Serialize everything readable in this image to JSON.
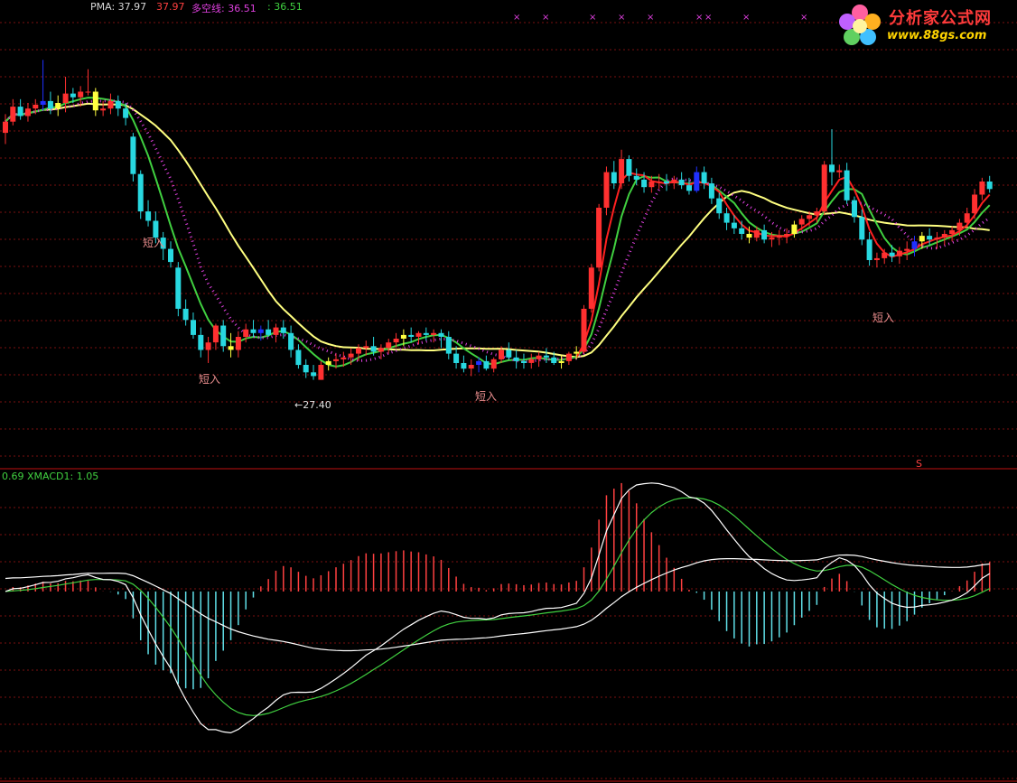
{
  "top_legend": {
    "pma_label": "PMA: 37.97",
    "pma_value2": "37.97",
    "dkx_label": "多空线: 36.51",
    "dkx_value2": ": 36.51"
  },
  "bottom_legend": {
    "left_label": "0.69 XMACD1: 1.05"
  },
  "logo": {
    "title": "分析家公式网",
    "url": "www.88gs.com"
  },
  "annotations": {
    "signal_1": "短入",
    "signal_2": "短入",
    "signal_3": "短入",
    "signal_4": "短入",
    "low_marker": "←27.40"
  },
  "colors": {
    "background": "#000000",
    "grid": "#7a1010",
    "up_candle": "#ff3030",
    "down_candle": "#28d8e0",
    "highlight_candle": "#ffff40",
    "blue_candle": "#2030ff",
    "yellow_ma": "#ffff80",
    "green_ma": "#40d040",
    "red_ma": "#ff2020",
    "pink_dot_ma": "#e040e0",
    "macd_white": "#ffffff",
    "macd_green": "#40d040",
    "hist_pos": "#ff4040",
    "hist_neg": "#60e0e8"
  },
  "chart_data": [
    {
      "type": "candlestick",
      "panel": "price",
      "title": "",
      "low_label": 27.4,
      "series": [
        {
          "name": "PMA",
          "last": 37.97
        },
        {
          "name": "多空线",
          "last": 36.51
        }
      ],
      "ohlc": [
        [
          40.6,
          41.6,
          40.0,
          41.2
        ],
        [
          41.2,
          42.4,
          41.0,
          42.0
        ],
        [
          42.0,
          42.4,
          41.3,
          41.5
        ],
        [
          41.5,
          42.2,
          41.2,
          41.9
        ],
        [
          41.9,
          42.4,
          41.6,
          42.1
        ],
        [
          42.1,
          44.5,
          41.8,
          42.3
        ],
        [
          42.3,
          42.8,
          41.6,
          41.9
        ],
        [
          41.9,
          42.6,
          41.5,
          42.2
        ],
        [
          42.2,
          43.6,
          41.7,
          42.7
        ],
        [
          42.7,
          43.0,
          42.2,
          42.5
        ],
        [
          42.5,
          43.1,
          42.0,
          42.8
        ],
        [
          42.8,
          44.0,
          42.6,
          42.8
        ],
        [
          42.8,
          43.0,
          41.5,
          41.8
        ],
        [
          41.8,
          42.3,
          41.5,
          41.9
        ],
        [
          41.9,
          42.7,
          41.6,
          42.3
        ],
        [
          42.3,
          42.6,
          41.5,
          41.9
        ],
        [
          41.9,
          42.2,
          41.0,
          41.4
        ],
        [
          40.4,
          40.6,
          38.0,
          38.4
        ],
        [
          38.4,
          38.6,
          36.0,
          36.4
        ],
        [
          36.4,
          37.0,
          35.6,
          35.9
        ],
        [
          35.9,
          36.4,
          34.7,
          35.0
        ],
        [
          35.0,
          35.3,
          33.8,
          34.4
        ],
        [
          34.4,
          34.8,
          33.4,
          33.7
        ],
        [
          33.4,
          33.7,
          30.8,
          31.2
        ],
        [
          31.2,
          31.7,
          30.3,
          30.6
        ],
        [
          30.6,
          31.0,
          29.6,
          29.8
        ],
        [
          29.8,
          30.2,
          28.6,
          29.0
        ],
        [
          29.0,
          29.7,
          28.3,
          29.4
        ],
        [
          29.4,
          30.4,
          29.0,
          30.3
        ],
        [
          30.3,
          30.6,
          28.9,
          29.2
        ],
        [
          29.2,
          29.9,
          28.6,
          29.0
        ],
        [
          29.0,
          30.0,
          28.6,
          29.7
        ],
        [
          29.7,
          30.4,
          29.4,
          30.1
        ],
        [
          30.1,
          30.6,
          29.7,
          29.9
        ],
        [
          29.9,
          30.3,
          29.5,
          30.1
        ],
        [
          30.1,
          30.6,
          29.7,
          29.8
        ],
        [
          29.8,
          30.4,
          29.4,
          30.2
        ],
        [
          30.2,
          30.6,
          29.6,
          29.9
        ],
        [
          29.9,
          30.3,
          28.6,
          29.0
        ],
        [
          29.0,
          29.3,
          28.0,
          28.2
        ],
        [
          28.2,
          28.5,
          27.5,
          27.8
        ],
        [
          27.8,
          28.2,
          27.4,
          27.6
        ],
        [
          27.4,
          28.4,
          27.4,
          28.2
        ],
        [
          28.2,
          28.6,
          27.9,
          28.4
        ],
        [
          28.4,
          28.8,
          28.0,
          28.5
        ],
        [
          28.5,
          28.9,
          28.1,
          28.6
        ],
        [
          28.6,
          29.1,
          28.2,
          28.8
        ],
        [
          28.8,
          29.3,
          28.4,
          29.1
        ],
        [
          29.1,
          29.5,
          28.7,
          29.2
        ],
        [
          29.2,
          29.7,
          28.7,
          28.9
        ],
        [
          28.9,
          29.3,
          28.5,
          29.1
        ],
        [
          29.1,
          29.6,
          28.8,
          29.4
        ],
        [
          29.4,
          29.9,
          29.1,
          29.6
        ],
        [
          29.6,
          30.1,
          29.2,
          29.8
        ],
        [
          29.8,
          30.2,
          29.4,
          29.7
        ],
        [
          29.7,
          30.0,
          29.3,
          29.9
        ],
        [
          29.9,
          30.2,
          29.5,
          29.8
        ],
        [
          29.8,
          30.1,
          29.4,
          29.9
        ],
        [
          29.9,
          30.1,
          29.1,
          29.7
        ],
        [
          29.7,
          30.0,
          28.5,
          28.8
        ],
        [
          28.8,
          29.2,
          28.0,
          28.3
        ],
        [
          28.3,
          28.7,
          27.8,
          28.0
        ],
        [
          28.0,
          28.5,
          27.6,
          28.2
        ],
        [
          28.2,
          28.6,
          27.8,
          28.4
        ],
        [
          28.4,
          28.7,
          27.9,
          28.0
        ],
        [
          28.0,
          28.6,
          27.8,
          28.5
        ],
        [
          28.5,
          29.2,
          28.3,
          29.0
        ],
        [
          29.0,
          29.4,
          28.5,
          28.6
        ],
        [
          28.6,
          29.0,
          28.0,
          28.4
        ],
        [
          28.4,
          28.8,
          28.0,
          28.3
        ],
        [
          28.3,
          28.8,
          28.0,
          28.5
        ],
        [
          28.5,
          28.9,
          28.1,
          28.7
        ],
        [
          28.7,
          29.1,
          28.3,
          28.6
        ],
        [
          28.6,
          28.9,
          28.2,
          28.3
        ],
        [
          28.3,
          28.7,
          28.0,
          28.4
        ],
        [
          28.4,
          28.9,
          28.2,
          28.8
        ],
        [
          28.8,
          29.2,
          28.5,
          28.9
        ],
        [
          28.9,
          31.4,
          28.8,
          31.2
        ],
        [
          31.2,
          33.6,
          31.0,
          33.4
        ],
        [
          33.4,
          36.8,
          33.2,
          36.6
        ],
        [
          36.6,
          38.8,
          36.2,
          38.5
        ],
        [
          38.5,
          39.1,
          37.6,
          37.9
        ],
        [
          37.9,
          39.7,
          37.6,
          39.2
        ],
        [
          39.2,
          39.4,
          38.0,
          38.3
        ],
        [
          38.3,
          38.7,
          37.8,
          38.1
        ],
        [
          38.1,
          38.5,
          37.4,
          37.7
        ],
        [
          37.7,
          38.3,
          37.4,
          38.0
        ],
        [
          38.0,
          38.4,
          37.6,
          38.0
        ],
        [
          38.0,
          38.4,
          37.5,
          37.9
        ],
        [
          37.9,
          38.3,
          37.6,
          38.1
        ],
        [
          38.1,
          38.5,
          37.6,
          37.8
        ],
        [
          37.8,
          38.2,
          37.3,
          37.5
        ],
        [
          37.5,
          38.8,
          37.4,
          38.5
        ],
        [
          38.5,
          38.8,
          37.6,
          37.9
        ],
        [
          37.9,
          38.2,
          36.8,
          37.1
        ],
        [
          37.1,
          37.4,
          36.0,
          36.3
        ],
        [
          36.3,
          36.6,
          35.4,
          35.8
        ],
        [
          35.8,
          36.2,
          35.2,
          35.5
        ],
        [
          35.5,
          35.9,
          34.9,
          35.2
        ],
        [
          35.2,
          35.6,
          34.7,
          35.0
        ],
        [
          35.0,
          35.6,
          34.8,
          35.4
        ],
        [
          35.4,
          35.7,
          34.7,
          34.9
        ],
        [
          34.9,
          35.3,
          34.5,
          35.0
        ],
        [
          35.0,
          35.4,
          34.6,
          35.1
        ],
        [
          35.1,
          35.5,
          34.7,
          35.2
        ],
        [
          35.2,
          35.9,
          35.0,
          35.7
        ],
        [
          35.7,
          36.2,
          35.4,
          36.0
        ],
        [
          36.0,
          36.4,
          35.6,
          36.2
        ],
        [
          36.2,
          36.6,
          35.8,
          36.4
        ],
        [
          36.4,
          39.1,
          36.2,
          38.9
        ],
        [
          38.9,
          40.8,
          37.8,
          38.5
        ],
        [
          38.5,
          38.9,
          38.2,
          38.6
        ],
        [
          38.6,
          39.0,
          36.8,
          37.0
        ],
        [
          37.0,
          37.2,
          35.8,
          36.1
        ],
        [
          36.1,
          36.5,
          34.6,
          34.9
        ],
        [
          34.9,
          35.3,
          33.5,
          33.8
        ],
        [
          33.8,
          34.2,
          33.4,
          33.9
        ],
        [
          33.9,
          34.4,
          33.6,
          34.2
        ],
        [
          34.2,
          34.6,
          33.7,
          34.0
        ],
        [
          34.0,
          34.5,
          33.6,
          34.3
        ],
        [
          34.3,
          34.8,
          33.8,
          34.4
        ],
        [
          34.4,
          35.1,
          34.0,
          34.8
        ],
        [
          34.8,
          35.3,
          34.4,
          35.1
        ],
        [
          35.1,
          35.5,
          34.6,
          34.9
        ],
        [
          34.9,
          35.3,
          34.4,
          35.0
        ],
        [
          35.0,
          35.4,
          34.6,
          35.2
        ],
        [
          35.2,
          35.6,
          34.8,
          35.4
        ],
        [
          35.4,
          36.0,
          35.1,
          35.8
        ],
        [
          35.8,
          36.6,
          35.5,
          36.3
        ],
        [
          36.3,
          37.6,
          36.0,
          37.3
        ],
        [
          37.3,
          38.2,
          37.0,
          38.0
        ],
        [
          38.0,
          38.3,
          37.4,
          37.6
        ]
      ]
    },
    {
      "type": "line",
      "panel": "indicator",
      "title": "XMACD1",
      "series": [
        {
          "name": "XMACD1",
          "last": 1.05
        }
      ]
    }
  ]
}
